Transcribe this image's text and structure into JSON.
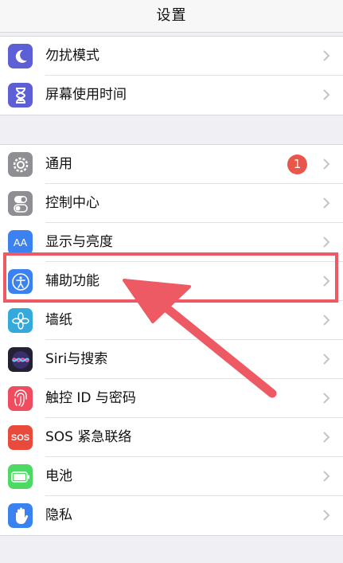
{
  "navbar": {
    "title": "设置"
  },
  "group1": [
    {
      "label": "勿扰模式",
      "icon": "moon-icon",
      "color": "#5c5fd6"
    },
    {
      "label": "屏幕使用时间",
      "icon": "hourglass-icon",
      "color": "#5c5fd6"
    }
  ],
  "group2": [
    {
      "label": "通用",
      "icon": "gear-icon",
      "color": "#8e8e93",
      "badge": "1"
    },
    {
      "label": "控制中心",
      "icon": "toggles-icon",
      "color": "#8e8e93"
    },
    {
      "label": "显示与亮度",
      "icon": "text-size-icon",
      "color": "#3b82f0",
      "glyph": "AA"
    },
    {
      "label": "辅助功能",
      "icon": "accessibility-icon",
      "color": "#3b82f0"
    },
    {
      "label": "墙纸",
      "icon": "flower-icon",
      "color": "#34aadc"
    },
    {
      "label": "Siri与搜索",
      "icon": "siri-icon",
      "color": "#222233"
    },
    {
      "label": "触控 ID 与密码",
      "icon": "fingerprint-icon",
      "color": "#ef4c5f"
    },
    {
      "label": "SOS 紧急联络",
      "icon": "sos-icon",
      "color": "#e84a3c",
      "glyph": "SOS"
    },
    {
      "label": "电池",
      "icon": "battery-icon",
      "color": "#4cd964"
    },
    {
      "label": "隐私",
      "icon": "hand-icon",
      "color": "#3b82f0"
    }
  ],
  "annotation": {
    "highlight_color": "#ee5a63",
    "target": "辅助功能"
  }
}
